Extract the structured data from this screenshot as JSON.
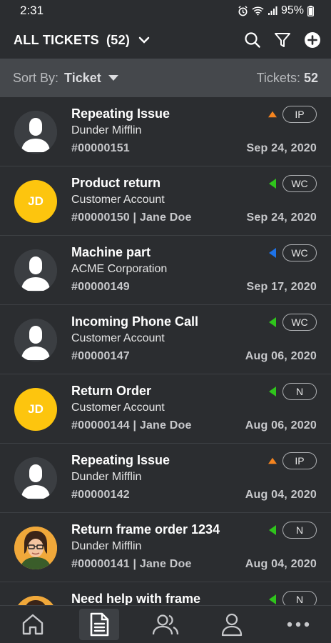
{
  "status": {
    "time": "2:31",
    "battery": "95%"
  },
  "header": {
    "title": "ALL TICKETS",
    "count": "(52)"
  },
  "sort": {
    "label": "Sort By:",
    "value": "Ticket",
    "tickets_label": "Tickets:",
    "tickets_count": "52"
  },
  "colors": {
    "orange": "#f5841f",
    "green": "#2fc41c",
    "blue": "#1e73e8",
    "avatar_yellow": "#fdc50e"
  },
  "tickets": [
    {
      "title": "Repeating Issue",
      "account": "Dunder Mifflin",
      "number": "#00000151",
      "date": "Sep 24, 2020",
      "status": "IP",
      "avatar": "person",
      "priority": "up-orange"
    },
    {
      "title": "Product return",
      "account": "Customer Account",
      "number": "#00000150  | Jane Doe",
      "date": "Sep 24, 2020",
      "status": "WC",
      "avatar": "JD",
      "priority": "left-green"
    },
    {
      "title": "Machine part",
      "account": "ACME Corporation",
      "number": "#00000149",
      "date": "Sep 17, 2020",
      "status": "WC",
      "avatar": "person",
      "priority": "left-blue"
    },
    {
      "title": "Incoming Phone Call",
      "account": "Customer Account",
      "number": "#00000147",
      "date": "Aug 06, 2020",
      "status": "WC",
      "avatar": "person",
      "priority": "left-green"
    },
    {
      "title": "Return Order",
      "account": "Customer Account",
      "number": "#00000144  | Jane Doe",
      "date": "Aug 06, 2020",
      "status": "N",
      "avatar": "JD",
      "priority": "left-green"
    },
    {
      "title": "Repeating Issue",
      "account": "Dunder Mifflin",
      "number": "#00000142",
      "date": "Aug 04, 2020",
      "status": "IP",
      "avatar": "person",
      "priority": "up-orange"
    },
    {
      "title": "Return frame order 1234",
      "account": "Dunder Mifflin",
      "number": "#00000141  | Jane Doe",
      "date": "Aug 04, 2020",
      "status": "N",
      "avatar": "photo",
      "priority": "left-green"
    },
    {
      "title": "Need help with frame",
      "account": "",
      "number": "",
      "date": "",
      "status": "N",
      "avatar": "photo",
      "priority": "left-green"
    }
  ],
  "nav": [
    "home-icon",
    "tickets-icon",
    "contacts-icon",
    "profile-icon",
    "more-icon"
  ]
}
